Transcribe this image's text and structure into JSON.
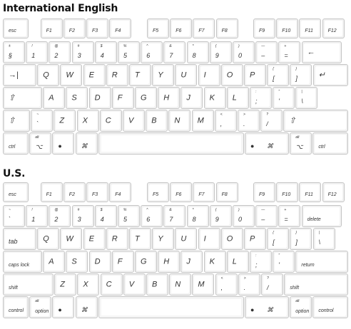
{
  "sections": [
    {
      "title": "International English",
      "layout": "intl",
      "rows": {
        "fn": [
          {
            "b": "esc"
          },
          {
            "b": "F1"
          },
          {
            "b": "F2"
          },
          {
            "b": "F3"
          },
          {
            "b": "F4"
          },
          {
            "b": "F5"
          },
          {
            "b": "F6"
          },
          {
            "b": "F7"
          },
          {
            "b": "F8"
          },
          {
            "b": "F9"
          },
          {
            "b": "F10"
          },
          {
            "b": "F11"
          },
          {
            "b": "F12"
          }
        ],
        "num": [
          {
            "t": "±",
            "b": "§"
          },
          {
            "t": "!",
            "b": "1"
          },
          {
            "t": "@",
            "b": "2"
          },
          {
            "t": "#",
            "b": "3"
          },
          {
            "t": "$",
            "b": "4"
          },
          {
            "t": "%",
            "b": "5"
          },
          {
            "t": "^",
            "b": "6"
          },
          {
            "t": "&",
            "b": "7"
          },
          {
            "t": "*",
            "b": "8"
          },
          {
            "t": "(",
            "b": "9"
          },
          {
            "t": ")",
            "b": "0"
          },
          {
            "t": "—",
            "b": "–"
          },
          {
            "t": "+",
            "b": "="
          },
          {
            "m": "←",
            "name": "backspace"
          }
        ],
        "qwerty": [
          {
            "m": "→|",
            "name": "tab"
          },
          {
            "m": "Q"
          },
          {
            "m": "W"
          },
          {
            "m": "E"
          },
          {
            "m": "R"
          },
          {
            "m": "T"
          },
          {
            "m": "Y"
          },
          {
            "m": "U"
          },
          {
            "m": "I"
          },
          {
            "m": "O"
          },
          {
            "m": "P"
          },
          {
            "t": "{",
            "b": "["
          },
          {
            "t": "}",
            "b": "]"
          }
        ],
        "enter": {
          "m": "↵"
        },
        "home": [
          {
            "m": "⇪",
            "name": "caps-lock"
          },
          {
            "m": "A"
          },
          {
            "m": "S"
          },
          {
            "m": "D"
          },
          {
            "m": "F"
          },
          {
            "m": "G"
          },
          {
            "m": "H"
          },
          {
            "m": "J"
          },
          {
            "m": "K"
          },
          {
            "m": "L"
          },
          {
            "t": ":",
            "b": ";"
          },
          {
            "t": "\"",
            "b": "'"
          },
          {
            "t": "|",
            "b": "\\"
          }
        ],
        "shift": [
          {
            "m": "⇧",
            "name": "left-shift"
          },
          {
            "t": "~",
            "b": "`"
          },
          {
            "m": "Z"
          },
          {
            "m": "X"
          },
          {
            "m": "C"
          },
          {
            "m": "V"
          },
          {
            "m": "B"
          },
          {
            "m": "N"
          },
          {
            "m": "M"
          },
          {
            "t": "<",
            "b": ","
          },
          {
            "t": ">",
            "b": "."
          },
          {
            "t": "?",
            "b": "/"
          },
          {
            "m": "⇧",
            "name": "right-shift"
          }
        ],
        "bottom": [
          {
            "b": "ctrl"
          },
          {
            "t": "alt",
            "b": "⌥"
          },
          {
            "b": "",
            "m": "",
            "icon": "apple"
          },
          {
            "b": "⌘"
          },
          {
            "b": ""
          },
          {
            "b": "⌘",
            "icon": "apple"
          },
          {
            "t": "alt",
            "b": "⌥"
          },
          {
            "b": "ctrl"
          }
        ]
      }
    },
    {
      "title": "U.S.",
      "layout": "us",
      "rows": {
        "fn": [
          {
            "b": "esc"
          },
          {
            "b": "F1"
          },
          {
            "b": "F2"
          },
          {
            "b": "F3"
          },
          {
            "b": "F4"
          },
          {
            "b": "F5"
          },
          {
            "b": "F6"
          },
          {
            "b": "F7"
          },
          {
            "b": "F8"
          },
          {
            "b": "F9"
          },
          {
            "b": "F10"
          },
          {
            "b": "F11"
          },
          {
            "b": "F12"
          }
        ],
        "num": [
          {
            "t": "~",
            "b": "`"
          },
          {
            "t": "!",
            "b": "1"
          },
          {
            "t": "@",
            "b": "2"
          },
          {
            "t": "#",
            "b": "3"
          },
          {
            "t": "$",
            "b": "4"
          },
          {
            "t": "%",
            "b": "5"
          },
          {
            "t": "^",
            "b": "6"
          },
          {
            "t": "&",
            "b": "7"
          },
          {
            "t": "*",
            "b": "8"
          },
          {
            "t": "(",
            "b": "9"
          },
          {
            "t": ")",
            "b": "0"
          },
          {
            "t": "—",
            "b": "–"
          },
          {
            "t": "+",
            "b": "="
          },
          {
            "b": "delete"
          }
        ],
        "qwerty": [
          {
            "b": "tab"
          },
          {
            "m": "Q"
          },
          {
            "m": "W"
          },
          {
            "m": "E"
          },
          {
            "m": "R"
          },
          {
            "m": "T"
          },
          {
            "m": "Y"
          },
          {
            "m": "U"
          },
          {
            "m": "I"
          },
          {
            "m": "O"
          },
          {
            "m": "P"
          },
          {
            "t": "{",
            "b": "["
          },
          {
            "t": "}",
            "b": "]"
          },
          {
            "t": "|",
            "b": "\\"
          }
        ],
        "home": [
          {
            "b": "caps lock"
          },
          {
            "m": "A"
          },
          {
            "m": "S"
          },
          {
            "m": "D"
          },
          {
            "m": "F"
          },
          {
            "m": "G"
          },
          {
            "m": "H"
          },
          {
            "m": "J"
          },
          {
            "m": "K"
          },
          {
            "m": "L"
          },
          {
            "t": ":",
            "b": ";"
          },
          {
            "t": "\"",
            "b": "'"
          },
          {
            "b": "return"
          }
        ],
        "shift": [
          {
            "b": "shift"
          },
          {
            "m": "Z"
          },
          {
            "m": "X"
          },
          {
            "m": "C"
          },
          {
            "m": "V"
          },
          {
            "m": "B"
          },
          {
            "m": "N"
          },
          {
            "m": "M"
          },
          {
            "t": "<",
            "b": ","
          },
          {
            "t": ">",
            "b": "."
          },
          {
            "t": "?",
            "b": "/"
          },
          {
            "b": "shift"
          }
        ],
        "bottom": [
          {
            "b": "control"
          },
          {
            "t": "alt",
            "b": "option"
          },
          {
            "b": "",
            "icon": "apple"
          },
          {
            "b": "⌘"
          },
          {
            "b": ""
          },
          {
            "b": "⌘",
            "icon": "apple"
          },
          {
            "t": "alt",
            "b": "option"
          },
          {
            "b": "control"
          }
        ]
      }
    }
  ]
}
